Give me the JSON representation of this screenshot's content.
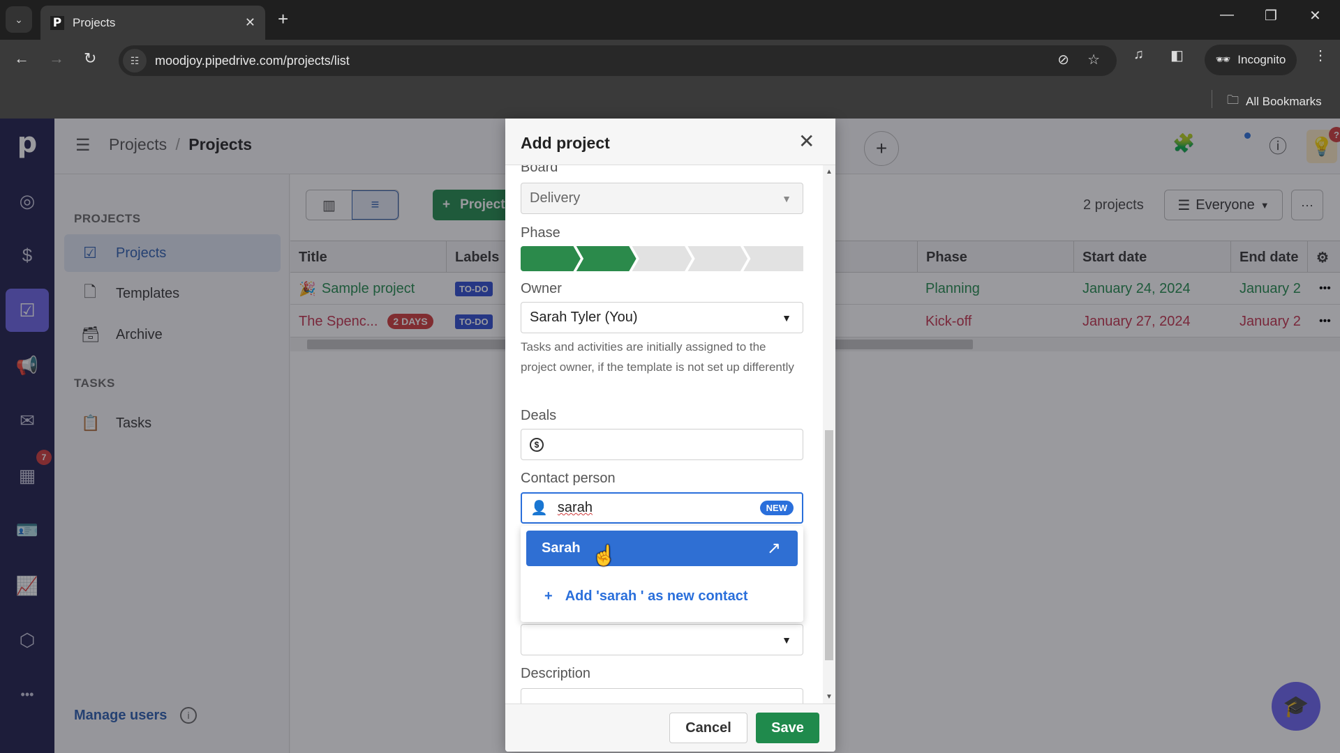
{
  "browser": {
    "tab_title": "Projects",
    "tab_favicon": "P",
    "url": "moodjoy.pipedrive.com/projects/list",
    "profile_label": "Incognito",
    "bookmarks_label": "All Bookmarks"
  },
  "app": {
    "logo": "p",
    "breadcrumb": {
      "parent": "Projects",
      "separator": "/",
      "current": "Projects"
    },
    "rail": {
      "items": [
        "target-icon",
        "dollar-icon",
        "projects-icon",
        "megaphone-icon",
        "mail-icon",
        "calendar-icon",
        "contacts-icon",
        "chart-icon",
        "box-icon",
        "more-icon"
      ],
      "calendar_badge": "7"
    },
    "topbar": {
      "bulb_badge": "?"
    },
    "sidebar": {
      "projects_header": "PROJECTS",
      "items": [
        {
          "label": "Projects",
          "active": true
        },
        {
          "label": "Templates",
          "active": false
        },
        {
          "label": "Archive",
          "active": false
        }
      ],
      "tasks_header": "TASKS",
      "tasks_items": [
        {
          "label": "Tasks"
        }
      ],
      "manage_users": "Manage users"
    },
    "toolbar": {
      "add_button": "Project",
      "count": "2 projects",
      "filter": "Everyone"
    },
    "table": {
      "columns": [
        "Title",
        "Labels",
        "Phase",
        "Start date",
        "End date"
      ],
      "rows": [
        {
          "title": "Sample project",
          "badge": "",
          "label": "TO-DO",
          "phase": "Planning",
          "start": "January 24, 2024",
          "end": "January 2",
          "status": "green"
        },
        {
          "title": "The Spenc...",
          "badge": "2 DAYS",
          "label": "TO-DO",
          "phase": "Kick-off",
          "start": "January 27, 2024",
          "end": "January 2",
          "status": "red"
        }
      ]
    }
  },
  "modal": {
    "title": "Add project",
    "board": {
      "label": "Board",
      "value": "Delivery"
    },
    "phase": {
      "label": "Phase",
      "total_steps": 5,
      "completed_steps": 2
    },
    "owner": {
      "label": "Owner",
      "value": "Sarah Tyler (You)",
      "helper": "Tasks and activities are initially assigned to the project owner, if the template is not set up differently"
    },
    "deals": {
      "label": "Deals",
      "value": ""
    },
    "contact": {
      "label": "Contact person",
      "value": "sarah",
      "badge": "NEW",
      "options": [
        {
          "label": "Sarah",
          "highlighted": true
        }
      ],
      "add_new": "Add 'sarah ' as new contact"
    },
    "description": {
      "label": "Description",
      "value": ""
    },
    "cancel": "Cancel",
    "save": "Save"
  },
  "colors": {
    "brand_green": "#1f8a4c",
    "rail_bg": "#1c1d4a",
    "accent_blue": "#2a6fdb",
    "danger_red": "#d03a3a"
  }
}
